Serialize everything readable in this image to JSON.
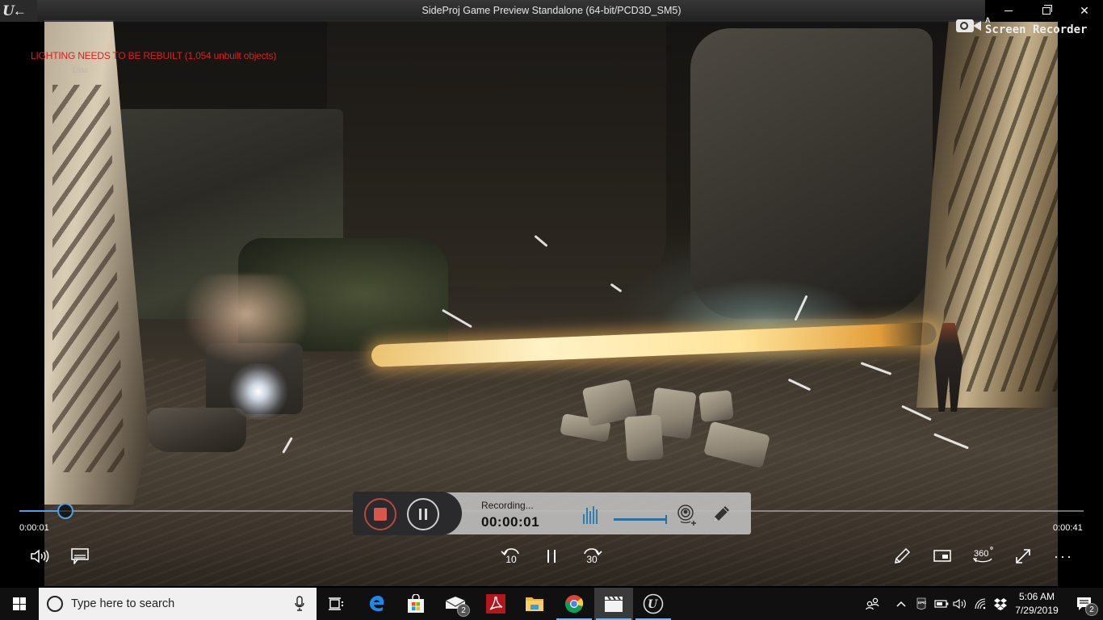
{
  "window": {
    "title": "SideProj Game Preview Standalone (64-bit/PCD3D_SM5)",
    "back_icon": "back-arrow-icon",
    "controls": [
      "minimize",
      "restore",
      "close"
    ]
  },
  "watermark": {
    "prefix": "A",
    "label": "Screen Recorder"
  },
  "game": {
    "warning": "LIGHTING NEEDS TO BE REBUILT (1,054 unbuilt objects)",
    "sub_message": "'Disc"
  },
  "player": {
    "current_time": "0:00:01",
    "total_time": "0:00:41",
    "progress_fraction": 0.043,
    "skip_back_seconds": "10",
    "skip_forward_seconds": "30",
    "vr_label": "360",
    "more_label": "···",
    "accent_color": "#4ba2e6"
  },
  "recorder": {
    "status": "Recording...",
    "elapsed": "00:00:01",
    "stop_color": "#d9564b",
    "accent_color": "#2b7fb0"
  },
  "taskbar": {
    "search_placeholder": "Type here to search",
    "apps": [
      {
        "name": "task-view",
        "active": false
      },
      {
        "name": "edge",
        "active": false
      },
      {
        "name": "store",
        "active": false
      },
      {
        "name": "mail",
        "badge": "2",
        "active": false
      },
      {
        "name": "acrobat",
        "active": false
      },
      {
        "name": "file-explorer",
        "active": false
      },
      {
        "name": "chrome",
        "active": false
      },
      {
        "name": "movies-tv",
        "active": true
      },
      {
        "name": "unreal-engine",
        "active": false
      }
    ],
    "tray": {
      "time": "5:06 AM",
      "date": "7/29/2019",
      "notification_count": "2",
      "epic_label": "EPIC"
    }
  }
}
